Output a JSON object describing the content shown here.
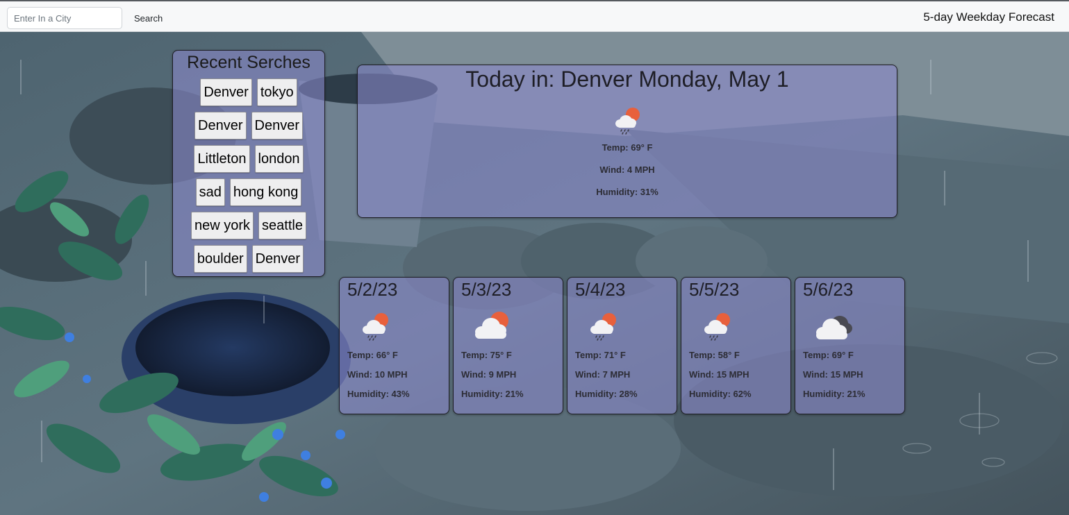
{
  "header": {
    "search_placeholder": "Enter In a City",
    "search_label": "Search",
    "brand": "5-day Weekday Forecast"
  },
  "recent": {
    "title": "Recent Serches",
    "items": [
      "Denver",
      "tokyo",
      "Denver",
      "Denver",
      "Littleton",
      "london",
      "sad",
      "hong kong",
      "new york",
      "seattle",
      "boulder",
      "Denver"
    ]
  },
  "today": {
    "title": "Today in: Denver Monday, May 1",
    "icon": "rain-with-sun-icon",
    "temp": "Temp: 69° F",
    "wind": "Wind: 4 MPH",
    "humidity": "Humidity: 31%"
  },
  "forecast": [
    {
      "date": "5/2/23",
      "icon": "rain-with-sun-icon",
      "temp": "Temp: 66° F",
      "wind": "Wind: 10 MPH",
      "humidity": "Humidity: 43%"
    },
    {
      "date": "5/3/23",
      "icon": "cloud-with-sun-icon",
      "temp": "Temp: 75° F",
      "wind": "Wind: 9 MPH",
      "humidity": "Humidity: 21%"
    },
    {
      "date": "5/4/23",
      "icon": "rain-with-sun-icon",
      "temp": "Temp: 71° F",
      "wind": "Wind: 7 MPH",
      "humidity": "Humidity: 28%"
    },
    {
      "date": "5/5/23",
      "icon": "rain-with-sun-icon",
      "temp": "Temp: 58° F",
      "wind": "Wind: 15 MPH",
      "humidity": "Humidity: 62%"
    },
    {
      "date": "5/6/23",
      "icon": "dark-clouds-icon",
      "temp": "Temp: 69° F",
      "wind": "Wind: 15 MPH",
      "humidity": "Humidity: 21%"
    }
  ],
  "colors": {
    "panel": "#8c8acd",
    "sun": "#e8603c",
    "cloud": "#f2f2f4",
    "dark_cloud": "#4a4a52"
  }
}
